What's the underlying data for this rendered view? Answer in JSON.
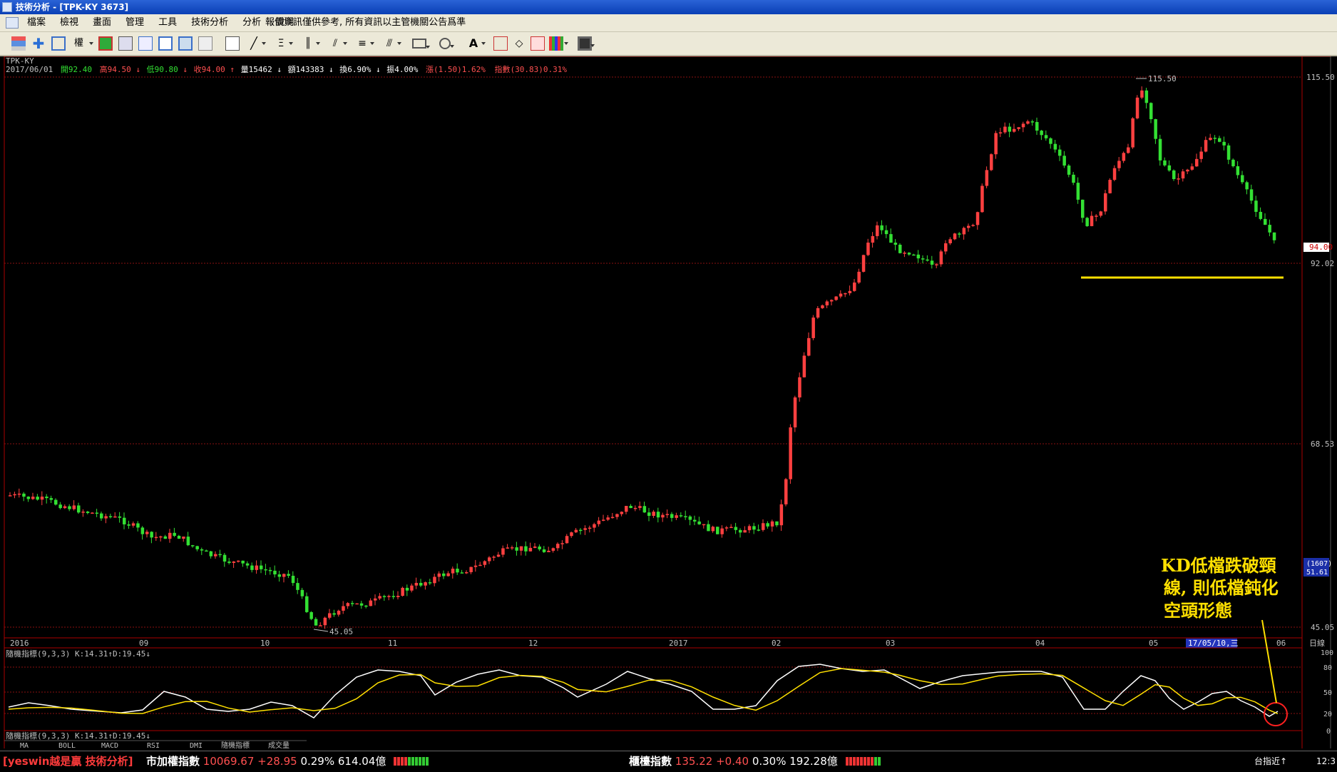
{
  "window": {
    "title": "技術分析 - [TPK-KY 3673]"
  },
  "menu": {
    "items": [
      "檔案",
      "檢視",
      "畫面",
      "管理",
      "工具",
      "技術分析",
      "分析",
      "說明"
    ],
    "notice": "報價資訊僅供參考, 所有資訊以主管機關公告爲準"
  },
  "toolbar": {
    "quan_label": "權"
  },
  "chart": {
    "symbol": "TPK-KY",
    "info": {
      "date": "2017/06/01",
      "open": "開92.40",
      "high": "高94.50",
      "low": "低90.80",
      "close": "收94.00",
      "volume": "量15462",
      "amount": "額143383",
      "turnover": "換6.90%",
      "amplitude": "振4.00%",
      "change": "漲(1.50)1.62%",
      "index": "指數(30.83)0.31%"
    },
    "price_labels": {
      "high": "115.50",
      "mid1": "92.02",
      "mid2": "68.53",
      "low": "45.05",
      "current": "94.00"
    },
    "annot_high": "115.50",
    "annot_low": "45.05",
    "x_labels": [
      "2016",
      "09",
      "10",
      "11",
      "12",
      "2017",
      "02",
      "03",
      "04",
      "05",
      "06"
    ],
    "cursor_date": "17/05/10,三",
    "period": "日線",
    "side_box": {
      "top": "(1607)",
      "bottom": "51.61"
    },
    "support_color": "#ffe000",
    "up_color": "#ff4040",
    "down_color": "#33e033",
    "kd": {
      "label": "隨機指標(9,3,3) K:14.31↑D:19.45↓",
      "label2": "隨機指標(9,3,3) K:14.31↑D:19.45↓",
      "axis": [
        "100",
        "80",
        "50",
        "20",
        "0"
      ]
    },
    "tabs": [
      "MA",
      "BOLL",
      "MACD",
      "RSI",
      "DMI",
      "隨機指標",
      "成交量"
    ],
    "annotation": [
      "KD低檔跌破頸",
      "線, 則低檔鈍化",
      "空頭形態"
    ]
  },
  "statusbar": {
    "brand": "[yeswin越是贏 技術分析]",
    "taiex": {
      "name": "市加權指數",
      "value": "10069.67",
      "change": "+28.95",
      "pct": "0.29%",
      "volume": "614.04億"
    },
    "otc": {
      "name": "櫃檯指數",
      "value": "135.22",
      "change": "+0.40",
      "pct": "0.30%",
      "volume": "192.28億"
    },
    "right_text": "台指近↑",
    "clock": "12:3"
  }
}
